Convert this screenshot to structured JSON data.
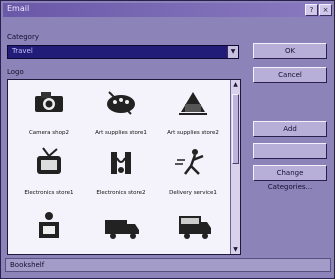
{
  "window": {
    "title": "Email",
    "buttons": [
      "?",
      "×"
    ]
  },
  "category": {
    "label": "Category",
    "value": "Travel"
  },
  "list": {
    "label": "Logo",
    "items": [
      {
        "label": "Camera shop2",
        "icon": "camera-icon"
      },
      {
        "label": "Art supplies store1",
        "icon": "art-supplies-icon"
      },
      {
        "label": "Art supplies store2",
        "icon": "art-supplies-icon"
      },
      {
        "label": "Electronics store1",
        "icon": "electronics-icon"
      },
      {
        "label": "Electronics store2",
        "icon": "electronics-icon"
      },
      {
        "label": "Delivery service1",
        "icon": "delivery-icon"
      },
      {
        "label": "",
        "icon": "delivery-icon"
      },
      {
        "label": "",
        "icon": "truck-icon"
      },
      {
        "label": "",
        "icon": "truck-icon"
      }
    ]
  },
  "buttons": {
    "ok": "OK",
    "cancel": "Cancel",
    "add": "Add",
    "delete": "",
    "change_categories": "Change Categories..."
  },
  "status": {
    "text": "Bookshelf"
  }
}
